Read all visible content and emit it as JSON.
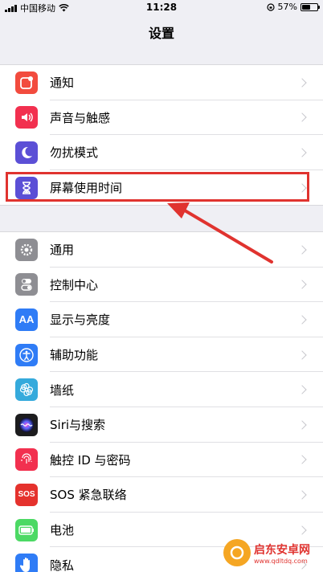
{
  "status_bar": {
    "carrier": "中国移动",
    "time": "11:28",
    "battery_percent": "57%",
    "battery_level": 0.57
  },
  "nav": {
    "title": "设置"
  },
  "groups": [
    {
      "items": [
        {
          "label": "通知",
          "icon": "notifications-icon",
          "color": "#f24b3e"
        },
        {
          "label": "声音与触感",
          "icon": "sound-icon",
          "color": "#f2304f"
        },
        {
          "label": "勿扰模式",
          "icon": "moon-icon",
          "color": "#5b4fd6"
        },
        {
          "label": "屏幕使用时间",
          "icon": "hourglass-icon",
          "color": "#5b4fd6"
        }
      ]
    },
    {
      "items": [
        {
          "label": "通用",
          "icon": "gear-icon",
          "color": "#8e8e93"
        },
        {
          "label": "控制中心",
          "icon": "toggles-icon",
          "color": "#8e8e93"
        },
        {
          "label": "显示与亮度",
          "icon": "display-icon",
          "color": "#2f7cf6"
        },
        {
          "label": "辅助功能",
          "icon": "accessibility-icon",
          "color": "#2f7cf6"
        },
        {
          "label": "墙纸",
          "icon": "wallpaper-icon",
          "color": "#35aadc"
        },
        {
          "label": "Siri与搜索",
          "icon": "siri-icon",
          "color": "#1c1c1e"
        },
        {
          "label": "触控 ID 与密码",
          "icon": "fingerprint-icon",
          "color": "#f2304f"
        },
        {
          "label": "SOS 紧急联络",
          "icon": "sos-icon",
          "color": "#e5322d"
        },
        {
          "label": "电池",
          "icon": "battery-icon",
          "color": "#4cd964"
        },
        {
          "label": "隐私",
          "icon": "hand-icon",
          "color": "#2f7cf6"
        }
      ]
    }
  ],
  "icon_text": {
    "display": "AA",
    "sos": "SOS"
  },
  "watermark": {
    "main": "启东安卓网",
    "sub": "www.qdltdq.com"
  },
  "accent_color": "#e0332f"
}
